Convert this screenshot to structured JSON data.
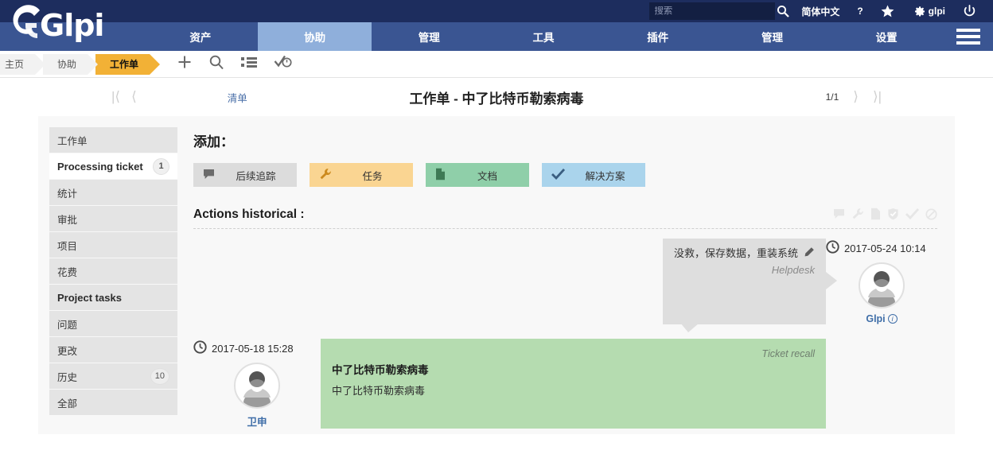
{
  "topbar": {
    "search_placeholder": "搜索",
    "search_value": "",
    "language": "简体中文",
    "help": "?",
    "username": "glpi",
    "icons": {
      "search": "search-icon",
      "star": "star-icon",
      "gear": "gear-icon",
      "power": "power-icon"
    }
  },
  "nav": {
    "items": [
      {
        "label": "资产",
        "active": false
      },
      {
        "label": "协助",
        "active": true
      },
      {
        "label": "管理",
        "active": false
      },
      {
        "label": "工具",
        "active": false
      },
      {
        "label": "插件",
        "active": false
      },
      {
        "label": "管理",
        "active": false
      },
      {
        "label": "设置",
        "active": false
      }
    ],
    "logo": "Glpi"
  },
  "breadcrumb": {
    "items": [
      {
        "label": "主页",
        "active": false
      },
      {
        "label": "协助",
        "active": false
      },
      {
        "label": "工作单",
        "active": true
      }
    ],
    "icons": [
      "plus-icon",
      "search-icon",
      "list-icon",
      "check-clock-icon"
    ]
  },
  "title_row": {
    "list_link": "清单",
    "title": "工作单 - 中了比特币勒索病毒",
    "pager": "1/1"
  },
  "sidebar": {
    "items": [
      {
        "label": "工作单",
        "badge": "",
        "active": false,
        "bold": false
      },
      {
        "label": "Processing ticket",
        "badge": "1",
        "active": true,
        "bold": true
      },
      {
        "label": "统计",
        "badge": "",
        "active": false,
        "bold": false
      },
      {
        "label": "审批",
        "badge": "",
        "active": false,
        "bold": false
      },
      {
        "label": "项目",
        "badge": "",
        "active": false,
        "bold": false
      },
      {
        "label": "花费",
        "badge": "",
        "active": false,
        "bold": false
      },
      {
        "label": "Project tasks",
        "badge": "",
        "active": false,
        "bold": true
      },
      {
        "label": "问题",
        "badge": "",
        "active": false,
        "bold": false
      },
      {
        "label": "更改",
        "badge": "",
        "active": false,
        "bold": false
      },
      {
        "label": "历史",
        "badge": "10",
        "active": false,
        "bold": false
      },
      {
        "label": "全部",
        "badge": "",
        "active": false,
        "bold": false
      }
    ]
  },
  "main": {
    "add_heading": "添加：",
    "actions": [
      {
        "label": "后续追踪",
        "icon": "comment-icon",
        "color": "#dcdcdc"
      },
      {
        "label": "任务",
        "icon": "wrench-icon",
        "color": "#fad592"
      },
      {
        "label": "文档",
        "icon": "document-icon",
        "color": "#8fcfa9"
      },
      {
        "label": "解决方案",
        "icon": "check-icon",
        "color": "#aad4ec"
      }
    ],
    "history_heading": "Actions historical :",
    "history_filters": [
      "comment-icon",
      "wrench-icon",
      "document-icon",
      "shield-check-icon",
      "check-icon",
      "ban-icon"
    ],
    "timeline": [
      {
        "side": "right",
        "timestamp": "2017-05-24 10:14",
        "author": "Glpi",
        "bubble_color": "#dedede",
        "text": "没救，保存数据，重装系统",
        "source": "Helpdesk",
        "editable": true
      },
      {
        "side": "left",
        "timestamp": "2017-05-18 15:28",
        "author": "卫申",
        "bubble_color": "#b5dcb0",
        "tag": "Ticket recall",
        "title": "中了比特币勒索病毒",
        "body": "中了比特币勒索病毒"
      }
    ]
  },
  "colors": {
    "header_navy": "#1d2d5e",
    "nav_blue": "#3a5592",
    "nav_active": "#8fafdb",
    "crumb_orange": "#f2b136",
    "link_blue": "#4a6fa8"
  }
}
